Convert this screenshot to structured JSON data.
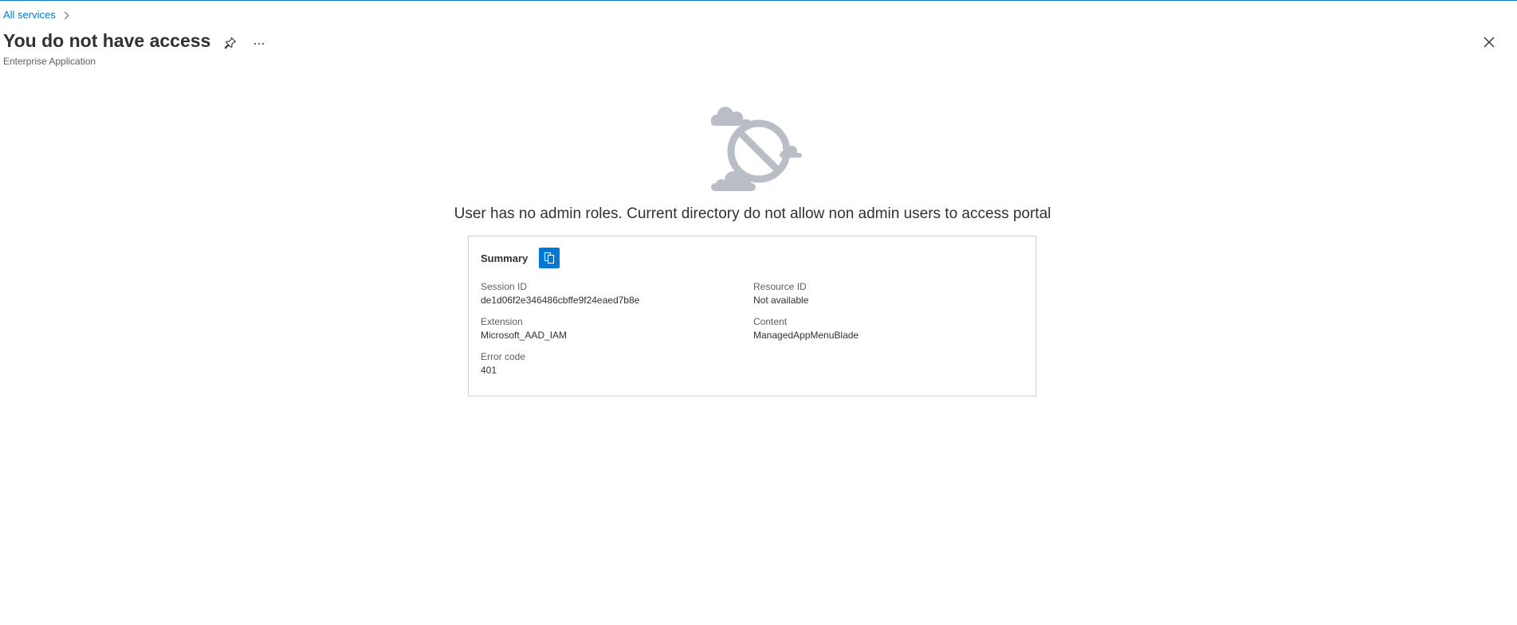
{
  "breadcrumb": {
    "link": "All services"
  },
  "header": {
    "title": "You do not have access",
    "subtitle": "Enterprise Application"
  },
  "message": "User has no admin roles. Current directory do not allow non admin users to access portal",
  "summary": {
    "title": "Summary",
    "fields": [
      {
        "label": "Session ID",
        "value": "de1d06f2e346486cbffe9f24eaed7b8e"
      },
      {
        "label": "Resource ID",
        "value": "Not available"
      },
      {
        "label": "Extension",
        "value": "Microsoft_AAD_IAM"
      },
      {
        "label": "Content",
        "value": "ManagedAppMenuBlade"
      },
      {
        "label": "Error code",
        "value": "401"
      }
    ]
  },
  "colors": {
    "accent": "#0078d4",
    "text": "#323130",
    "muted": "#605e5c",
    "illustration": "#b9bec6"
  },
  "icons": {
    "pin": "pin-icon",
    "more": "more-icon",
    "close": "close-icon",
    "copy": "copy-icon",
    "chevron": "chevron-right-icon",
    "illustration": "no-access-cloud-illustration"
  }
}
